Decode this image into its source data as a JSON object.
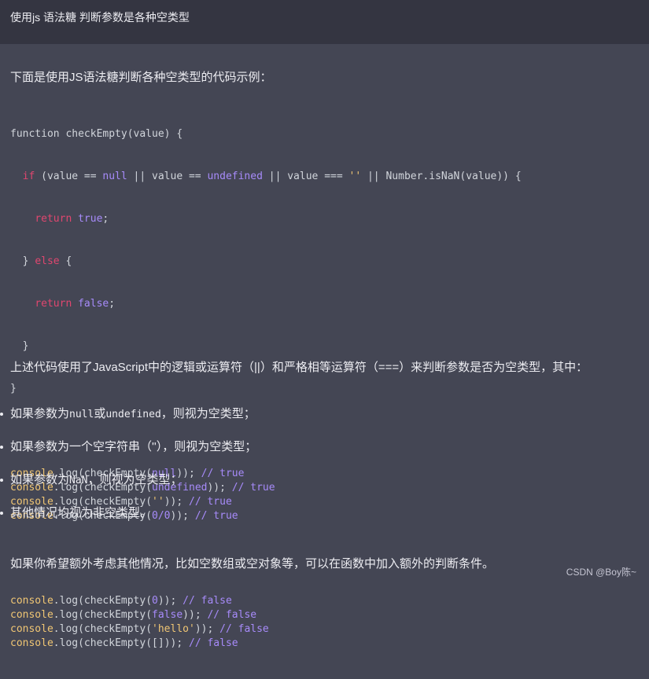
{
  "prompt": {
    "text": "使用js 语法糖 判断参数是各种空类型"
  },
  "answer": {
    "intro": "下面是使用JS语法糖判断各种空类型的代码示例：",
    "code": {
      "l1": "function checkEmpty(value) {",
      "l2_a": "  ",
      "l2_if": "if",
      "l2_b": " (value == ",
      "l2_null": "null",
      "l2_c": " || value == ",
      "l2_undef": "undefined",
      "l2_d": " || value === ",
      "l2_str": "''",
      "l2_e": " || Number.isNaN(value)) {",
      "l3_ret": "return",
      "l3_val": "true",
      "l4_close": "  } ",
      "l4_else": "else",
      "l4_open": " {",
      "l5_ret": "return",
      "l5_val": "false",
      "l6": "  }",
      "l7": "}",
      "logs": [
        {
          "arg": "null",
          "comment": "// true",
          "arg_type": "lit"
        },
        {
          "arg": "undefined",
          "comment": "// true",
          "arg_type": "lit"
        },
        {
          "arg": "''",
          "comment": "// true",
          "arg_type": "str"
        },
        {
          "arg": "0/0",
          "comment": "// true",
          "arg_type": "lit"
        },
        {
          "arg": "0",
          "comment": "// false",
          "arg_type": "lit"
        },
        {
          "arg": "false",
          "comment": "// false",
          "arg_type": "lit"
        },
        {
          "arg": "'hello'",
          "comment": "// false",
          "arg_type": "str"
        },
        {
          "arg": "[]",
          "comment": "// false",
          "arg_type": "plain"
        }
      ],
      "console_obj": "console",
      "console_method": ".log(checkEmpty(",
      "console_close": ")); "
    },
    "summary": "上述代码使用了JavaScript中的逻辑或运算符（||）和严格相等运算符（===）来判断参数是否为空类型，其中：",
    "bullets": [
      {
        "pre": "如果参数为",
        "code1": "null",
        "mid": "或",
        "code2": "undefined",
        "post": "，则视为空类型；"
      },
      {
        "pre": "如果参数为一个空字符串（''），则视为空类型；",
        "code1": "",
        "mid": "",
        "code2": "",
        "post": ""
      },
      {
        "pre": "如果参数为",
        "code1": "NaN",
        "mid": "",
        "code2": "",
        "post": "，则视为空类型；"
      },
      {
        "pre": "其他情况均视为非空类型。",
        "code1": "",
        "mid": "",
        "code2": "",
        "post": ""
      }
    ],
    "closing": "如果你希望额外考虑其他情况，比如空数组或空对象等，可以在函数中加入额外的判断条件。"
  },
  "watermark": "CSDN @Boy陈~",
  "colors": {
    "background": "#444654",
    "prompt_background": "#343541",
    "keyword": "#e0466f",
    "literal": "#a78bfa",
    "string": "#f0c674"
  }
}
